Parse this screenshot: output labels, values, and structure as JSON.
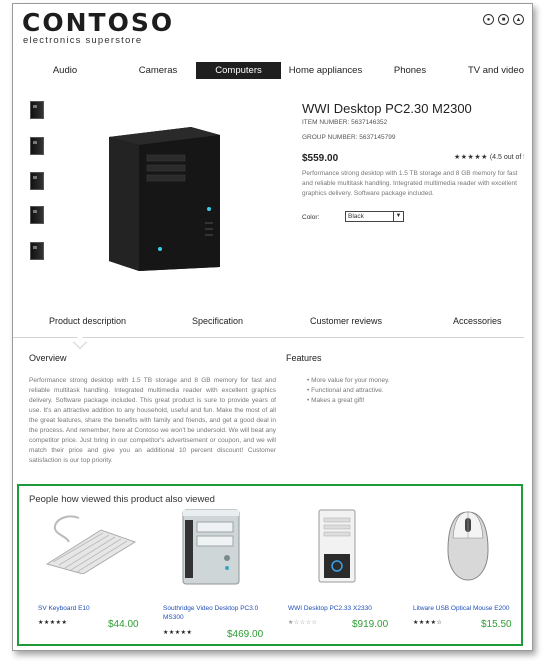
{
  "brand": {
    "logo": "CONTOSO",
    "tagline": "electronics superstore"
  },
  "header_icons": [
    "location-icon",
    "user-icon",
    "cart-icon"
  ],
  "nav": [
    {
      "label": "Audio",
      "active": false
    },
    {
      "label": "Cameras",
      "active": false
    },
    {
      "label": "Computers",
      "active": true
    },
    {
      "label": "Home appliances",
      "active": false
    },
    {
      "label": "Phones",
      "active": false
    },
    {
      "label": "TV and video",
      "active": false
    }
  ],
  "product": {
    "title": "WWI Desktop PC2.30 M2300",
    "item_number": "ITEM NUMBER: 5637146352",
    "group_number": "GROUP NUMBER: 5637145799",
    "price": "$559.00",
    "stars": "★★★★★",
    "rating": "(4.5 out of 5",
    "description": "Performance strong desktop with 1.5 TB storage and 8 GB memory for fast and reliable multitask handling. Integrated multimedia reader with excellent graphics delivery. Software package included.",
    "color_label": "Color:",
    "color_value": "Black"
  },
  "tabs": [
    "Product description",
    "Specification",
    "Customer reviews",
    "Accessories"
  ],
  "overview": {
    "title": "Overview",
    "text": "Performance strong desktop with 1.5 TB storage and 8 GB memory for fast and reliable multitask handling. Integrated multimedia reader with excellent graphics delivery. Software package included. This great product is sure to provide years of use. It's an attractive addition to any household, useful and fun. Make the most of all the great features, share the benefits with family and friends, and get a good deal in the process. And remember, here at Contoso we won't be undersold. We will beat any competitor price. Just bring in our competitor's advertisement or coupon, and we will match their price and give you an additional 10 percent discount! Customer satisfaction is our top priority."
  },
  "features": {
    "title": "Features",
    "items": [
      "More value for your money.",
      "Functional and attractive.",
      "Makes a great gift!"
    ]
  },
  "also_viewed": {
    "title": "People how viewed this product also viewed",
    "items": [
      {
        "name": "SV Keyboard E10",
        "stars": "★★★★★",
        "price": "$44.00",
        "icon": "keyboard-icon"
      },
      {
        "name": "Southridge Video Desktop PC3.0 MS300",
        "stars": "★★★★★",
        "price": "$469.00",
        "icon": "desktop-icon"
      },
      {
        "name": "WWI Desktop PC2.33 X2330",
        "stars": "★☆☆☆☆",
        "price": "$919.00",
        "icon": "pc-tower-icon"
      },
      {
        "name": "Litware USB Optical Mouse E200",
        "stars": "★★★★☆",
        "price": "$15.50",
        "icon": "mouse-icon"
      }
    ]
  },
  "colors": {
    "accent_green": "#1e9a3a",
    "price_green": "#2e9c34",
    "link_blue": "#1f4fb8",
    "nav_active": "#1f1f1f"
  }
}
